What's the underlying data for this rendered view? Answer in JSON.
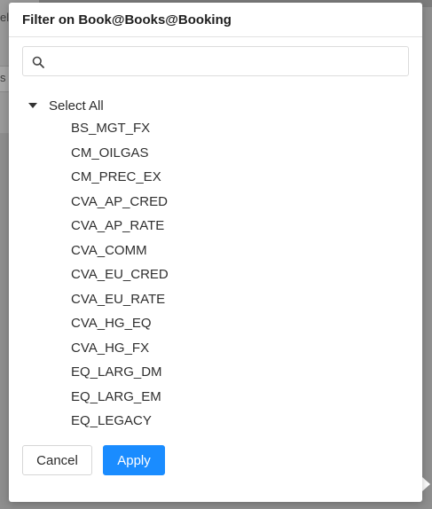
{
  "background": {
    "fragment_text_1": "el",
    "fragment_text_2": "s"
  },
  "modal": {
    "title": "Filter on Book@Books@Booking"
  },
  "search": {
    "value": "",
    "placeholder": "",
    "icon": "search-icon"
  },
  "tree": {
    "root_label": "Select All",
    "root_expanded": true,
    "items": [
      {
        "label": "BS_MGT_FX"
      },
      {
        "label": "CM_OILGAS"
      },
      {
        "label": "CM_PREC_EX"
      },
      {
        "label": "CVA_AP_CRED"
      },
      {
        "label": "CVA_AP_RATE"
      },
      {
        "label": "CVA_COMM"
      },
      {
        "label": "CVA_EU_CRED"
      },
      {
        "label": "CVA_EU_RATE"
      },
      {
        "label": "CVA_HG_EQ"
      },
      {
        "label": "CVA_HG_FX"
      },
      {
        "label": "EQ_LARG_DM"
      },
      {
        "label": "EQ_LARG_EM"
      },
      {
        "label": "EQ_LEGACY"
      }
    ]
  },
  "footer": {
    "cancel_label": "Cancel",
    "apply_label": "Apply"
  },
  "colors": {
    "primary": "#1a8cff",
    "overlay": "#8e8e8e"
  }
}
